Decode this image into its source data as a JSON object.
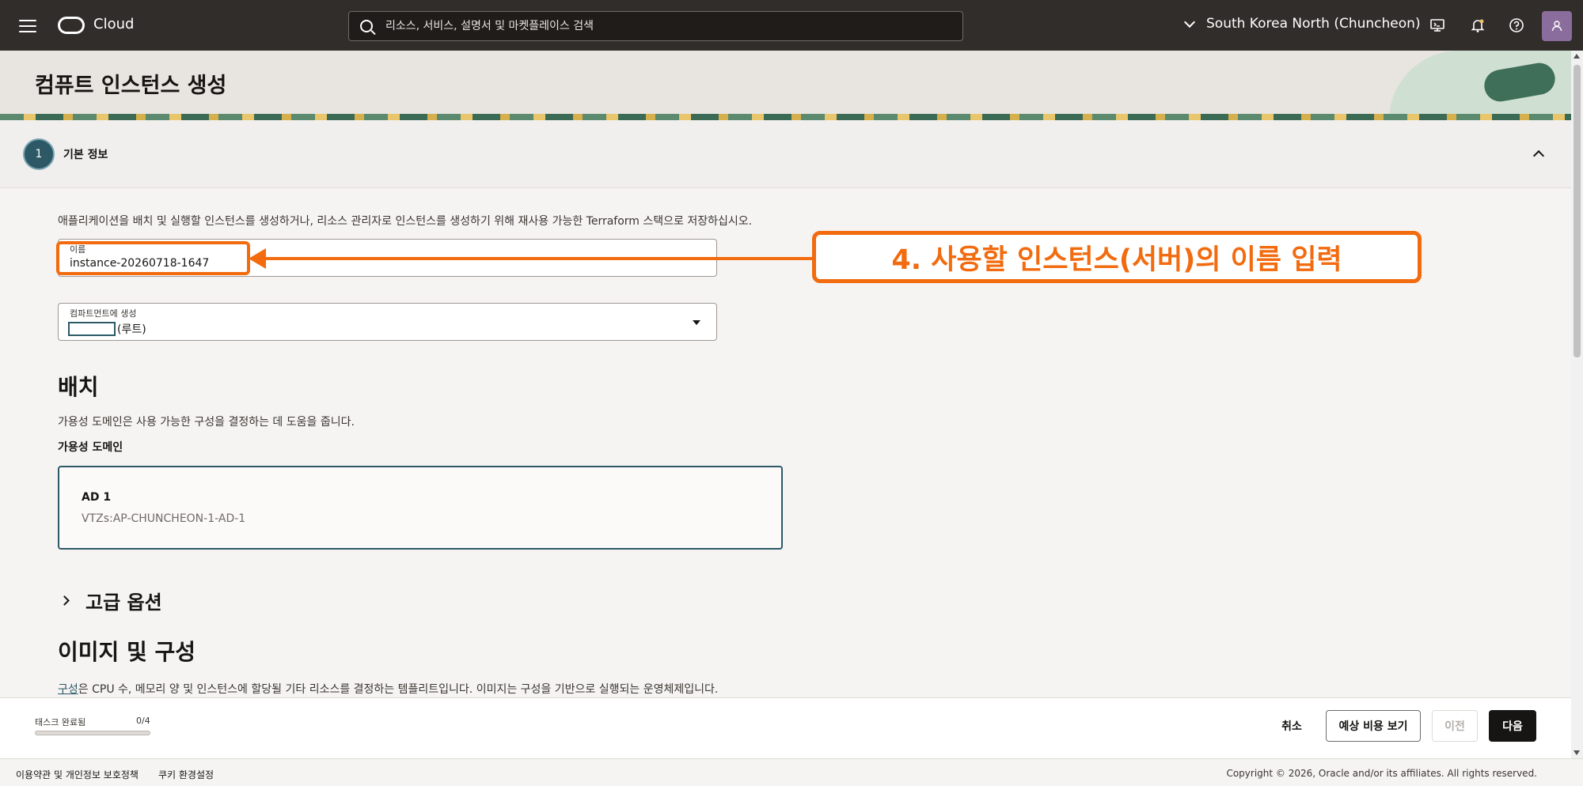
{
  "topbar": {
    "brand": "Cloud",
    "search_placeholder": "리소스, 서비스, 설명서 및 마켓플레이스 검색",
    "region": "South Korea North (Chuncheon)",
    "icons": [
      "menu-icon",
      "oracle-logo-icon",
      "search-icon",
      "chevron-down-icon",
      "cloud-shell-icon",
      "bell-icon",
      "help-icon",
      "user-icon"
    ]
  },
  "page": {
    "title": "컴퓨트 인스턴스 생성"
  },
  "step": {
    "number": "1",
    "label": "기본 정보"
  },
  "form": {
    "intro": "애플리케이션을 배치 및 실행할 인스턴스를 생성하거나, 리소스 관리자로 인스턴스를 생성하기 위해 재사용 가능한 Terraform 스택으로 저장하십시오.",
    "name_label": "이름",
    "name_value": "instance-20260718-1647",
    "compartment_label": "컴파트먼트에 생성",
    "compartment_value": "(루트)"
  },
  "annotation": {
    "callout": "4. 사용할 인스턴스(서버)의 이름 입력",
    "color": "#f26b0f"
  },
  "placement": {
    "title": "배치",
    "description": "가용성 도메인은 사용 가능한 구성을 결정하는 데 도움을 줍니다.",
    "ad_label": "가용성 도메인",
    "ad_title": "AD 1",
    "ad_value": "VTZs:AP-CHUNCHEON-1-AD-1"
  },
  "advanced": {
    "label": "고급 옵션"
  },
  "image_section": {
    "title": "이미지 및 구성",
    "link_text": "구성",
    "description_rest": "은 CPU 수, 메모리 양 및 인스턴스에 할당될 기타 리소스를 결정하는 템플리트입니다. 이미지는 구성을 기반으로 실행되는 운영체제입니다."
  },
  "action_bar": {
    "task_label": "태스크 완료됨",
    "task_count": "0/4",
    "progress": 0,
    "cancel": "취소",
    "estimate": "예상 비용 보기",
    "previous": "이전",
    "next": "다음"
  },
  "footer": {
    "terms": "이용약관 및 개인정보 보호정책",
    "cookies": "쿠키 환경설정",
    "copyright": "Copyright © 2026, Oracle and/or its affiliates. All rights reserved."
  },
  "colors": {
    "topbar": "#312d2a",
    "accent": "#2d5967",
    "primary_button": "#161513"
  }
}
